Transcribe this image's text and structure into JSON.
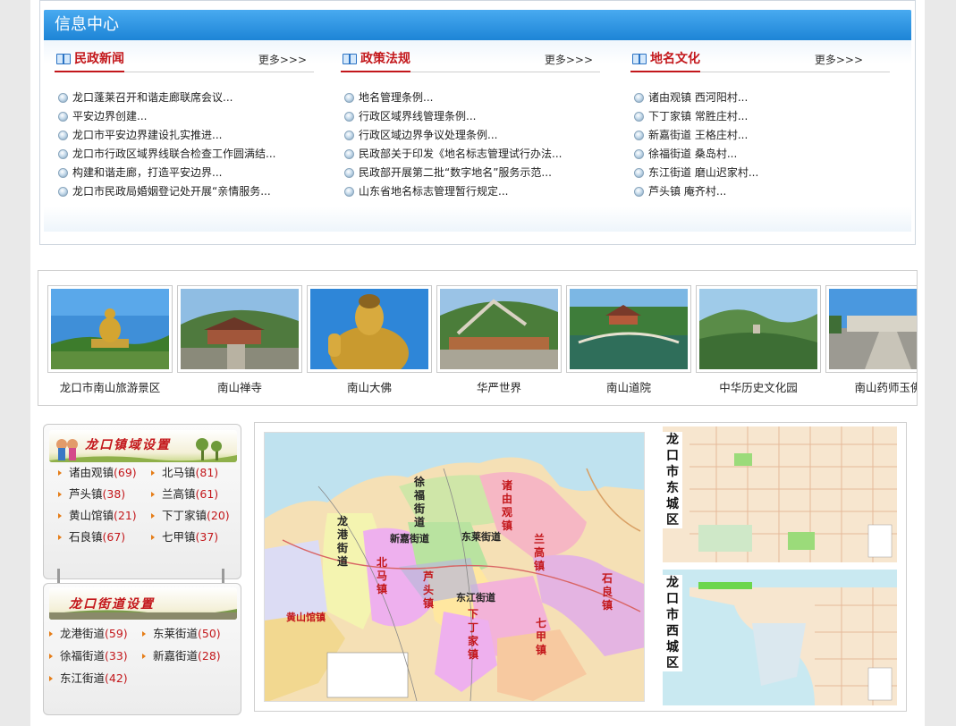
{
  "info_center": {
    "title": "信息中心",
    "columns": [
      {
        "title": "民政新闻",
        "more": "更多>>>",
        "items": [
          "龙口蓬莱召开和谐走廊联席会议...",
          "平安边界创建...",
          "龙口市平安边界建设扎实推进...",
          "龙口市行政区域界线联合检查工作圆满结...",
          "构建和谐走廊，打造平安边界...",
          "龙口市民政局婚姻登记处开展“亲情服务..."
        ]
      },
      {
        "title": "政策法规",
        "more": "更多>>>",
        "items": [
          "地名管理条例...",
          "行政区域界线管理条例...",
          "行政区域边界争议处理条例...",
          "民政部关于印发《地名标志管理试行办法...",
          "民政部开展第二批“数字地名”服务示范...",
          "山东省地名标志管理暂行规定..."
        ]
      },
      {
        "title": "地名文化",
        "more": "更多>>>",
        "items": [
          "诸由观镇 西河阳村...",
          "下丁家镇 常胜庄村...",
          "新嘉街道 王格庄村...",
          "徐福街道 桑岛村...",
          "东江街道 磨山迟家村...",
          "芦头镇 庵齐村..."
        ]
      }
    ]
  },
  "scenic_spots": [
    {
      "caption": "龙口市南山旅游景区",
      "image": "giant-buddha-landscape"
    },
    {
      "caption": "南山禅寺",
      "image": "temple-complex"
    },
    {
      "caption": "南山大佛",
      "image": "golden-buddha"
    },
    {
      "caption": "华严世界",
      "image": "great-wall-terraces"
    },
    {
      "caption": "南山道院",
      "image": "taoist-garden-lake"
    },
    {
      "caption": "中华历史文化园",
      "image": "mountain-park"
    },
    {
      "caption": "南山药师玉佛",
      "image": "jade-buddha-plaza"
    }
  ],
  "towns": {
    "banner": "龙口镇域设置",
    "items": [
      {
        "name": "诸由观镇",
        "count": "(69)"
      },
      {
        "name": "北马镇",
        "count": "(81)"
      },
      {
        "name": "芦头镇",
        "count": "(38)"
      },
      {
        "name": "兰高镇",
        "count": "(61)"
      },
      {
        "name": "黄山馆镇",
        "count": "(21)"
      },
      {
        "name": "下丁家镇",
        "count": "(20)"
      },
      {
        "name": "石良镇",
        "count": "(67)"
      },
      {
        "name": "七甲镇",
        "count": "(37)"
      }
    ]
  },
  "streets": {
    "banner": "龙口街道设置",
    "items": [
      {
        "name": "龙港街道",
        "count": "(59)"
      },
      {
        "name": "东莱街道",
        "count": "(50)"
      },
      {
        "name": "徐福街道",
        "count": "(33)"
      },
      {
        "name": "新嘉街道",
        "count": "(28)"
      },
      {
        "name": "东江街道",
        "count": "(42)"
      }
    ]
  },
  "maps": {
    "main_labels": {
      "longgang": "龙港街道",
      "xufu": "徐福街道",
      "zhuyouguan": "诸由观镇",
      "xinjia": "新嘉街道",
      "donglai": "东莱街道",
      "lanqgao": "兰高镇",
      "beima": "北马镇",
      "lutou": "芦头镇",
      "dongjiang": "东江街道",
      "shiliang": "石良镇",
      "huangshanguan": "黄山馆镇",
      "xiadingjia": "下丁家镇",
      "qijia": "七甲镇"
    },
    "east_title": "龙口市东城区",
    "west_title": "龙口市西城区"
  }
}
